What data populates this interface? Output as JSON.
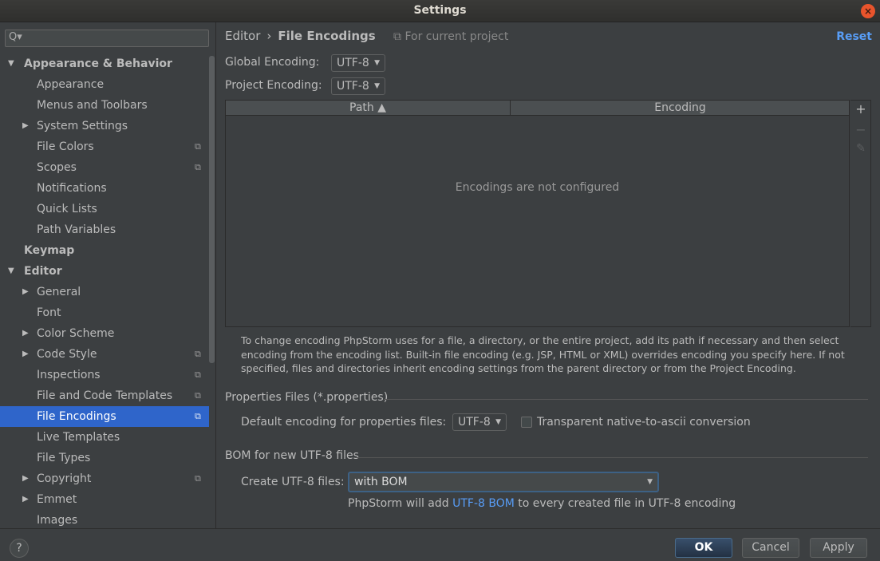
{
  "window": {
    "title": "Settings",
    "close_icon": "×"
  },
  "search": {
    "placeholder": "",
    "value": "",
    "icon": "Q▾"
  },
  "sidebar": {
    "items": [
      {
        "label": "Appearance & Behavior",
        "level": 0,
        "arrow": "▼",
        "bold": true,
        "scope": false
      },
      {
        "label": "Appearance",
        "level": 1,
        "arrow": "",
        "bold": false,
        "scope": false
      },
      {
        "label": "Menus and Toolbars",
        "level": 1,
        "arrow": "",
        "bold": false,
        "scope": false
      },
      {
        "label": "System Settings",
        "level": 1,
        "arrow": "▶",
        "bold": false,
        "scope": false
      },
      {
        "label": "File Colors",
        "level": 1,
        "arrow": "",
        "bold": false,
        "scope": true
      },
      {
        "label": "Scopes",
        "level": 1,
        "arrow": "",
        "bold": false,
        "scope": true
      },
      {
        "label": "Notifications",
        "level": 1,
        "arrow": "",
        "bold": false,
        "scope": false
      },
      {
        "label": "Quick Lists",
        "level": 1,
        "arrow": "",
        "bold": false,
        "scope": false
      },
      {
        "label": "Path Variables",
        "level": 1,
        "arrow": "",
        "bold": false,
        "scope": false
      },
      {
        "label": "Keymap",
        "level": 0,
        "arrow": "",
        "bold": true,
        "scope": false
      },
      {
        "label": "Editor",
        "level": 0,
        "arrow": "▼",
        "bold": true,
        "scope": false
      },
      {
        "label": "General",
        "level": 1,
        "arrow": "▶",
        "bold": false,
        "scope": false
      },
      {
        "label": "Font",
        "level": 1,
        "arrow": "",
        "bold": false,
        "scope": false
      },
      {
        "label": "Color Scheme",
        "level": 1,
        "arrow": "▶",
        "bold": false,
        "scope": false
      },
      {
        "label": "Code Style",
        "level": 1,
        "arrow": "▶",
        "bold": false,
        "scope": true
      },
      {
        "label": "Inspections",
        "level": 1,
        "arrow": "",
        "bold": false,
        "scope": true
      },
      {
        "label": "File and Code Templates",
        "level": 1,
        "arrow": "",
        "bold": false,
        "scope": true
      },
      {
        "label": "File Encodings",
        "level": 1,
        "arrow": "",
        "bold": false,
        "scope": true,
        "selected": true
      },
      {
        "label": "Live Templates",
        "level": 1,
        "arrow": "",
        "bold": false,
        "scope": false
      },
      {
        "label": "File Types",
        "level": 1,
        "arrow": "",
        "bold": false,
        "scope": false
      },
      {
        "label": "Copyright",
        "level": 1,
        "arrow": "▶",
        "bold": false,
        "scope": true
      },
      {
        "label": "Emmet",
        "level": 1,
        "arrow": "▶",
        "bold": false,
        "scope": false
      },
      {
        "label": "Images",
        "level": 1,
        "arrow": "",
        "bold": false,
        "scope": false
      }
    ],
    "scope_icon": "⧉"
  },
  "header": {
    "breadcrumb_parent": "Editor",
    "breadcrumb_sep": "›",
    "breadcrumb_current": "File Encodings",
    "scope_note": "⧉ For current project",
    "reset_label": "Reset"
  },
  "encodings": {
    "global_label": "Global Encoding:",
    "global_value": "UTF-8",
    "project_label": "Project Encoding:",
    "project_value": "UTF-8",
    "caret": "▼"
  },
  "table": {
    "col_path": "Path ▲",
    "col_encoding": "Encoding",
    "empty_text": "Encodings are not configured",
    "add_icon": "+",
    "remove_icon": "−",
    "edit_icon": "✎"
  },
  "help_text": "To change encoding PhpStorm uses for a file, a directory, or the entire project, add its path if necessary and then select encoding from the encoding list. Built-in file encoding (e.g. JSP, HTML or XML) overrides encoding you specify here. If not specified, files and directories inherit encoding settings from the parent directory or from the Project Encoding.",
  "properties": {
    "section_title": "Properties Files (*.properties)",
    "default_label": "Default encoding for properties files:",
    "default_value": "UTF-8",
    "transparent_label": "Transparent native-to-ascii conversion"
  },
  "bom": {
    "section_title": "BOM for new UTF-8 files",
    "create_label": "Create UTF-8 files:",
    "create_value": "with BOM",
    "note_before": "PhpStorm will add ",
    "note_link": "UTF-8 BOM",
    "note_after": " to every created file in UTF-8 encoding"
  },
  "footer": {
    "help_label": "?",
    "ok_label": "OK",
    "cancel_label": "Cancel",
    "apply_label": "Apply"
  }
}
